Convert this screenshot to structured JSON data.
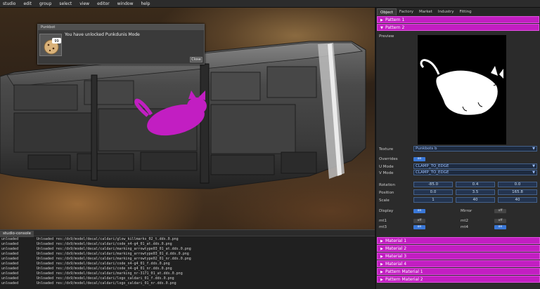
{
  "menu": [
    "studio",
    "edit",
    "group",
    "select",
    "view",
    "editor",
    "window",
    "help"
  ],
  "notification": {
    "title": "Punkbot",
    "message": "You have unlocked Punkdunis Mode",
    "close_label": "Close",
    "bubble": "99"
  },
  "console": {
    "tab": "studio-console",
    "lines": [
      {
        "status": "unloaded",
        "text": "Unloaded res:/dx9/model/decal/caldari/glow_killmarks_02_t.dds.0.png"
      },
      {
        "status": "unloaded",
        "text": "Unloaded res:/dx9/model/decal/caldari/code_n4-g4_01_at.dds.0.png"
      },
      {
        "status": "unloaded",
        "text": "Unloaded res:/dx9/model/decal/caldari/marking_arrowtype03_01_at.dds.0.png"
      },
      {
        "status": "unloaded",
        "text": "Unloaded res:/dx9/model/decal/caldari/marking_arrowtype03_01_d.dds.0.png"
      },
      {
        "status": "unloaded",
        "text": "Unloaded res:/dx9/model/decal/caldari/marking_arrowtype02_01_nr.dds.0.png"
      },
      {
        "status": "unloaded",
        "text": "Unloaded res:/dx9/model/decal/caldari/code_n4-g4_01_f.dds.0.png"
      },
      {
        "status": "unloaded",
        "text": "Unloaded res:/dx9/model/decal/caldari/code_n4-g4_01_nr.dds.0.png"
      },
      {
        "status": "unloaded",
        "text": "Unloaded res:/dx9/model/decal/caldari/marking_nr-3171_01_at.dds.0.png"
      },
      {
        "status": "unloaded",
        "text": "Unloaded res:/dx9/model/decal/caldari/logo_caldari_01_f.dds.0.png"
      },
      {
        "status": "unloaded",
        "text": "Unloaded res:/dx9/model/decal/caldari/logo_caldari_01_nr.dds.0.png"
      }
    ]
  },
  "side": {
    "tabs": [
      "Object",
      "Factory",
      "Market",
      "Industry",
      "Fitting"
    ],
    "active_tab": "Object",
    "pattern1": "Pattern 1",
    "pattern2": "Pattern 2",
    "preview_label": "Preview",
    "texture_label": "Texture",
    "texture_value": "Punkbots b",
    "overrides_label": "Overrides",
    "overrides_state": "on",
    "umode_label": "U Mode",
    "umode_value": "CLAMP_TO_EDGE",
    "vmode_label": "V Mode",
    "vmode_value": "CLAMP_TO_EDGE",
    "rotation_label": "Rotation",
    "rotation": [
      "-85.0",
      "0.4",
      "0.0"
    ],
    "position_label": "Position",
    "position": [
      "0.0",
      "3.5",
      "165.8"
    ],
    "scale_label": "Scale",
    "scale": [
      "1",
      "40",
      "40"
    ],
    "display_label": "Display",
    "display_state": "on",
    "mirror_label": "Mirror",
    "mirror_state": "off",
    "mt1_label": "mt1",
    "mt1_state": "off",
    "mt2_label": "mt2",
    "mt2_state": "off",
    "mt3_label": "mt3",
    "mt3_state": "on",
    "mt4_label": "mt4",
    "mt4_state": "on",
    "materials": [
      "Material 1",
      "Material 2",
      "Material 3",
      "Material 4",
      "Pattern Material 1",
      "Pattern Material 2"
    ]
  },
  "colors": {
    "accent": "#c21ec2",
    "input_bg": "#1e2b40",
    "toggle_on": "#3a78d8",
    "cat": "#c21ec2"
  }
}
